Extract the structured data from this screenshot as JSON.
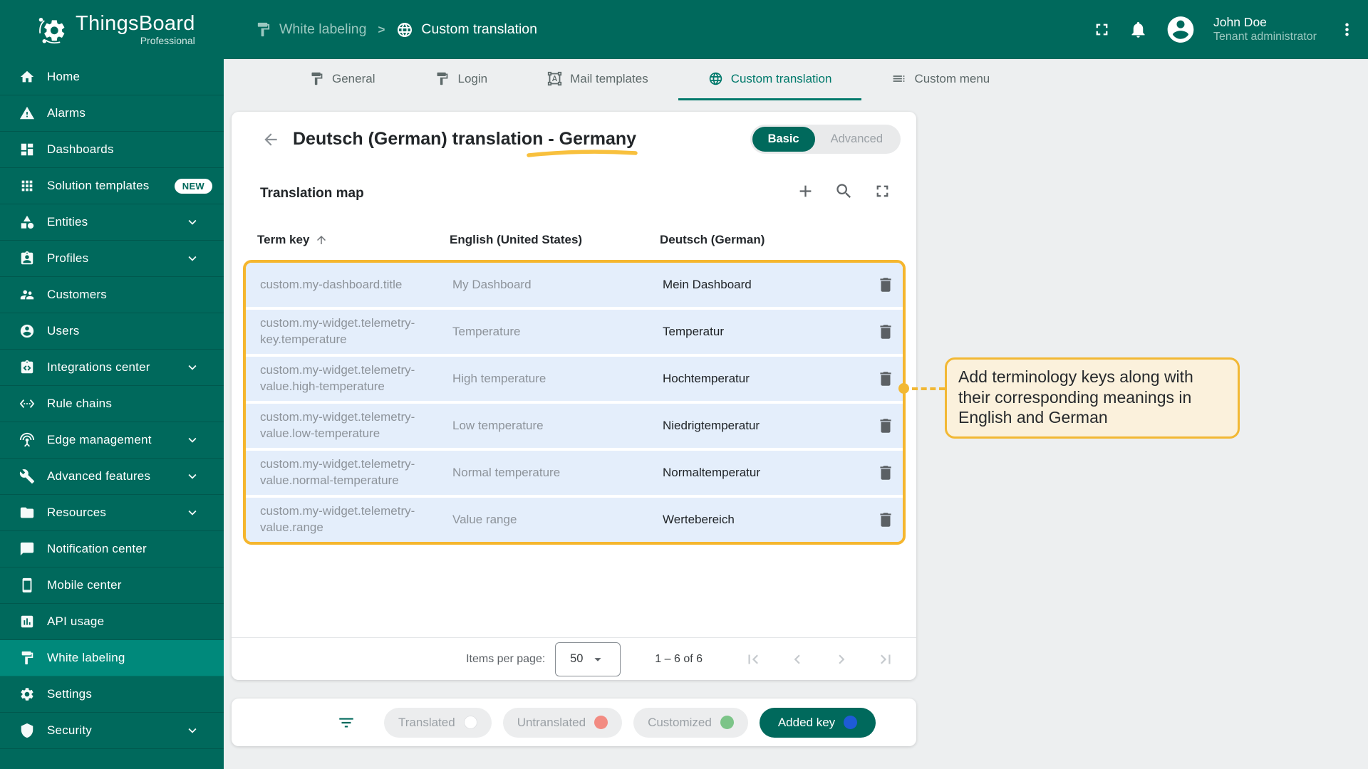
{
  "colors": {
    "primary": "#00695c",
    "primary_light": "#00897b",
    "active_tab": "#00796b",
    "highlight_border": "#f5b62e",
    "row_bg": "#e4eefb",
    "callout_bg": "#fbf1dc",
    "dot_translated": "#ffffff",
    "dot_untranslated": "#f28b82",
    "dot_customized": "#7cc488",
    "dot_added": "#1e5bd6"
  },
  "header": {
    "logo_title": "ThingsBoard",
    "logo_subtitle": "Professional",
    "logo_icon": "thingsboard-logo",
    "breadcrumb": [
      {
        "label": "White labeling",
        "icon": "white-labeling"
      },
      {
        "label": "Custom translation",
        "icon": "globe"
      }
    ],
    "breadcrumb_separator": ">",
    "icons": [
      "fullscreen-icon",
      "bell-icon",
      "kebab-icon"
    ],
    "user": {
      "name": "John Doe",
      "role": "Tenant administrator",
      "avatar_icon": "account-circle"
    }
  },
  "sidebar": {
    "items": [
      {
        "label": "Home",
        "icon": "home"
      },
      {
        "label": "Alarms",
        "icon": "alarms"
      },
      {
        "label": "Dashboards",
        "icon": "dashboards"
      },
      {
        "label": "Solution templates",
        "icon": "solution-templates",
        "badge": "NEW"
      },
      {
        "label": "Entities",
        "icon": "entities",
        "expandable": true
      },
      {
        "label": "Profiles",
        "icon": "profiles",
        "expandable": true
      },
      {
        "label": "Customers",
        "icon": "customers"
      },
      {
        "label": "Users",
        "icon": "users"
      },
      {
        "label": "Integrations center",
        "icon": "integrations-center",
        "expandable": true
      },
      {
        "label": "Rule chains",
        "icon": "rule-chains"
      },
      {
        "label": "Edge management",
        "icon": "edge-management",
        "expandable": true
      },
      {
        "label": "Advanced features",
        "icon": "advanced-features",
        "expandable": true
      },
      {
        "label": "Resources",
        "icon": "resources",
        "expandable": true
      },
      {
        "label": "Notification center",
        "icon": "notification-center"
      },
      {
        "label": "Mobile center",
        "icon": "mobile-center"
      },
      {
        "label": "API usage",
        "icon": "api-usage"
      },
      {
        "label": "White labeling",
        "icon": "white-labeling",
        "active": true
      },
      {
        "label": "Settings",
        "icon": "settings"
      },
      {
        "label": "Security",
        "icon": "security",
        "expandable": true
      }
    ]
  },
  "tabs": [
    {
      "label": "General",
      "icon": "white-labeling"
    },
    {
      "label": "Login",
      "icon": "white-labeling"
    },
    {
      "label": "Mail templates",
      "icon": "mail-templates"
    },
    {
      "label": "Custom translation",
      "icon": "globe",
      "active": true
    },
    {
      "label": "Custom menu",
      "icon": "custom-menu"
    }
  ],
  "panel": {
    "title": "Deutsch (German) translation - Germany",
    "toggle": {
      "options": [
        "Basic",
        "Advanced"
      ],
      "selected": "Basic"
    },
    "table": {
      "title": "Translation map",
      "toolbar_icons": [
        "plus-icon",
        "search-icon",
        "fullscreen-icon"
      ],
      "columns": {
        "key": "Term key",
        "en": "English (United States)",
        "de": "Deutsch (German)"
      },
      "sorted_column": "Term key",
      "sort_direction": "asc",
      "rows": [
        {
          "key": "custom.my-dashboard.title",
          "en": "My Dashboard",
          "de": "Mein Dashboard"
        },
        {
          "key": "custom.my-widget.telemetry-key.temperature",
          "en": "Temperature",
          "de": "Temperatur"
        },
        {
          "key": "custom.my-widget.telemetry-value.high-temperature",
          "en": "High temperature",
          "de": "Hochtemperatur"
        },
        {
          "key": "custom.my-widget.telemetry-value.low-temperature",
          "en": "Low temperature",
          "de": "Niedrigtemperatur"
        },
        {
          "key": "custom.my-widget.telemetry-value.normal-temperature",
          "en": "Normal temperature",
          "de": "Normaltemperatur"
        },
        {
          "key": "custom.my-widget.telemetry-value.range",
          "en": "Value range",
          "de": "Wertebereich"
        }
      ]
    },
    "pagination": {
      "items_per_page_label": "Items per page:",
      "items_per_page": "50",
      "range": "1 – 6 of 6",
      "pager_icons": [
        "first-page-icon",
        "prev-page-icon",
        "next-page-icon",
        "last-page-icon"
      ]
    }
  },
  "legend": {
    "filter_icon": "filter-icon",
    "chips": [
      {
        "label": "Translated",
        "dot": "#ffffff"
      },
      {
        "label": "Untranslated",
        "dot": "#f28b82"
      },
      {
        "label": "Customized",
        "dot": "#7cc488"
      }
    ],
    "added_chip": {
      "label": "Added key",
      "dot": "#1e5bd6"
    }
  },
  "annotation": {
    "text": "Add terminology keys along with their corresponding meanings in English and German"
  }
}
